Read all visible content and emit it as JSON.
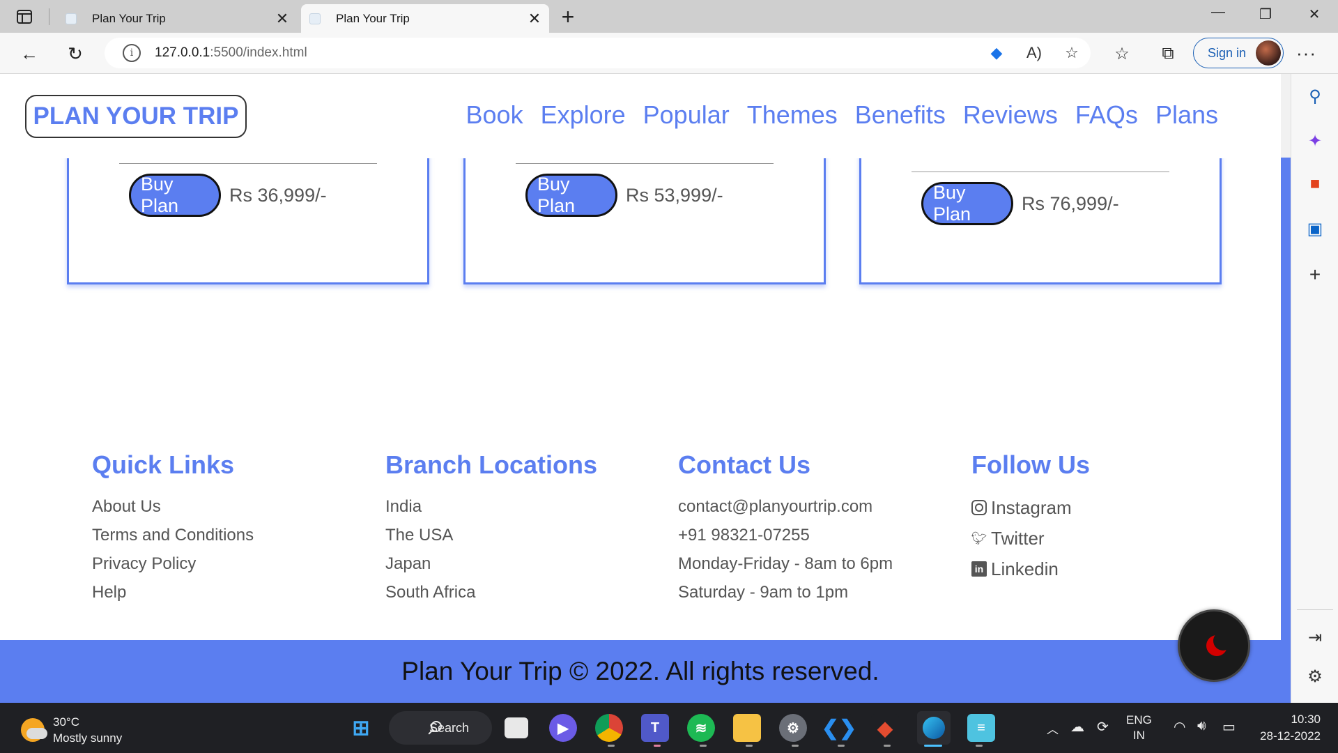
{
  "browser": {
    "tabs": [
      {
        "title": "Plan Your Trip",
        "active": false
      },
      {
        "title": "Plan Your Trip",
        "active": true
      }
    ],
    "url_host": "127.0.0.1",
    "url_path": ":5500/index.html",
    "signin_label": "Sign in"
  },
  "header": {
    "logo": "PLAN YOUR TRIP",
    "nav": [
      "Book",
      "Explore",
      "Popular",
      "Themes",
      "Benefits",
      "Reviews",
      "FAQs",
      "Plans"
    ]
  },
  "plans": [
    {
      "button": "Buy Plan",
      "price": "Rs 36,999/-"
    },
    {
      "button": "Buy Plan",
      "price": "Rs 53,999/-"
    },
    {
      "button": "Buy Plan",
      "price": "Rs 76,999/-"
    }
  ],
  "footer": {
    "quick_links": {
      "title": "Quick Links",
      "items": [
        "About Us",
        "Terms and Conditions",
        "Privacy Policy",
        "Help"
      ]
    },
    "branches": {
      "title": "Branch Locations",
      "items": [
        "India",
        "The USA",
        "Japan",
        "South Africa"
      ]
    },
    "contact": {
      "title": "Contact Us",
      "items": [
        "contact@planyourtrip.com",
        "+91 98321-07255",
        "Monday-Friday - 8am to 6pm",
        "Saturday - 9am to 1pm"
      ]
    },
    "follow": {
      "title": "Follow Us",
      "items": [
        "Instagram",
        "Twitter",
        "Linkedin"
      ]
    },
    "copyright": "Plan Your Trip © 2022. All rights reserved."
  },
  "taskbar": {
    "temperature": "30°C",
    "weather": "Mostly sunny",
    "search_label": "Search",
    "lang": "ENG",
    "region": "IN",
    "time": "10:30",
    "date": "28-12-2022"
  },
  "colors": {
    "accent": "#5b7ef0",
    "taskbar": "#1f2024",
    "moon": "#d30000"
  }
}
